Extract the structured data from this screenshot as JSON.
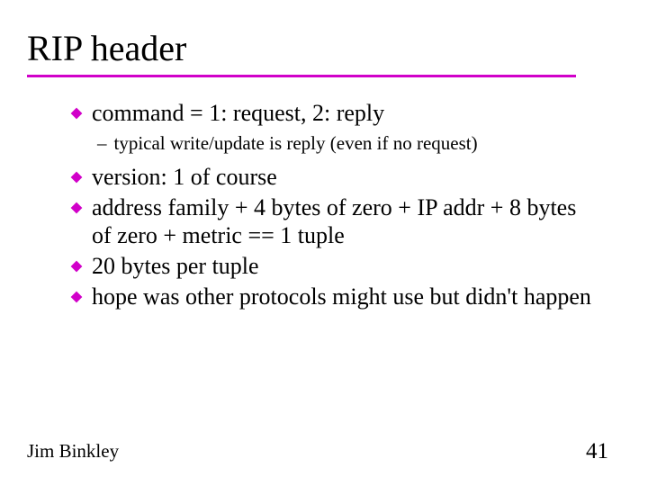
{
  "title": "RIP header",
  "bullets": {
    "b0": "command = 1: request,  2: reply",
    "b0_sub": "typical write/update is reply (even if no request)",
    "b1": "version: 1 of course",
    "b2": "address family + 4 bytes of zero + IP addr + 8 bytes of zero + metric == 1 tuple",
    "b3": "20 bytes per tuple",
    "b4": "hope was other protocols might use but didn't happen"
  },
  "footer": {
    "author": "Jim Binkley",
    "page": "41"
  },
  "colors": {
    "accent": "#d100c9"
  }
}
